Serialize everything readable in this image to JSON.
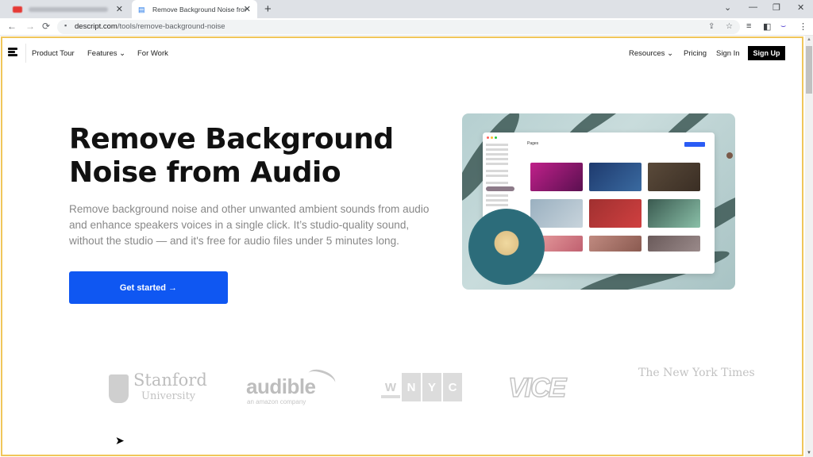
{
  "browser": {
    "tabs": [
      {
        "title": "",
        "favicon": "youtube-icon",
        "active": false,
        "blurred": true
      },
      {
        "title": "Remove Background Noise from",
        "favicon": "descript-doc-icon",
        "active": true
      }
    ],
    "new_tab_label": "+",
    "window_controls": {
      "dropdown": "⌄",
      "minimize": "—",
      "restore": "❐",
      "close": "✕"
    },
    "url_domain": "descript.com",
    "url_path": "/tools/remove-background-noise",
    "icons": {
      "back": "←",
      "forward": "→",
      "reload": "⟳",
      "lock": "🔒",
      "share": "⇪",
      "star": "☆",
      "media": "≡",
      "sidepanel": "◧",
      "profile": "⌣",
      "menu": "⋮"
    }
  },
  "site_nav": {
    "links_left": [
      "Product Tour",
      "Features",
      "For Work"
    ],
    "links_right": [
      "Resources",
      "Pricing",
      "Sign In"
    ],
    "features_chevron": "⌄",
    "resources_chevron": "⌄",
    "signup_label": "Sign Up"
  },
  "hero": {
    "title": "Remove Background Noise from Audio",
    "description": "Remove background noise and other unwanted ambient sounds from audio and enhance speakers voices in a single click. It’s studio-quality sound, without the studio — and it's free for audio files under 5 minutes long.",
    "cta_label": "Get started →",
    "app_preview_title": "Pages"
  },
  "logos": {
    "stanford": {
      "name": "Stanford",
      "sub": "University"
    },
    "audible": {
      "name": "audible",
      "sub": "an amazon company"
    },
    "wnyc": [
      "W",
      "N",
      "Y",
      "C"
    ],
    "vice": "VICE",
    "nyt": "The New York Times"
  },
  "colors": {
    "cta": "#0f57f2",
    "frame_highlight": "#f0c65a",
    "signup_bg": "#000000"
  }
}
